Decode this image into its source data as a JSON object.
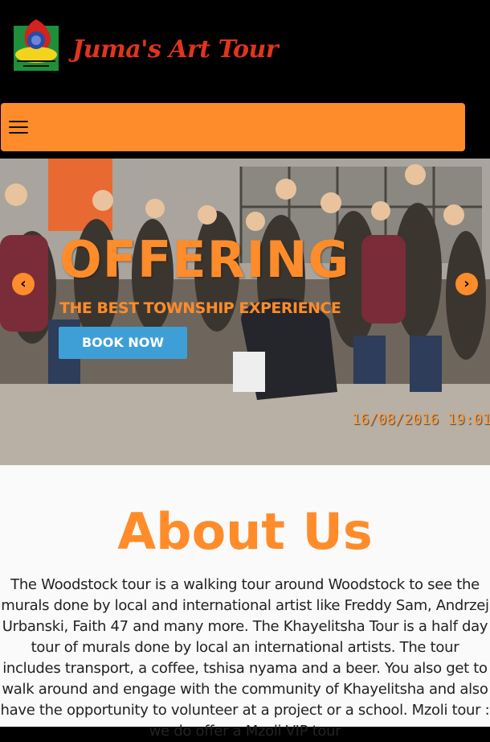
{
  "header": {
    "logo_text": "Juma's Art Tour",
    "logo_icon": "globe-emblem-icon"
  },
  "navbar": {
    "menu_icon": "hamburger-menu-icon",
    "background_color": "#ff8c2a"
  },
  "hero": {
    "title": "OFFERING",
    "subtitle": "THE BEST TOWNSHIP EXPERIENCE",
    "button_label": "BOOK NOW",
    "timestamp": "16/08/2016 19:01",
    "prev_icon": "chevron-left-icon",
    "next_icon": "chevron-right-icon",
    "prev_glyph": "‹",
    "next_glyph": "›",
    "button_color": "#3e9fd6"
  },
  "about": {
    "title": "About Us",
    "body": "The Woodstock tour is a walking tour around Woodstock to see the murals done by local and international artist like Freddy Sam, Andrzej Urbanski, Faith 47 and many more. The Khayelitsha Tour is a half day tour of murals done by local an international artists. The tour includes transport, a coffee, tshisa nyama and a beer. You also get to walk around and engage with the community of Khayelitsha and also have the opportunity to volunteer at a project or a school. Mzoli tour : we do offer a Mzoli VIP tour"
  }
}
